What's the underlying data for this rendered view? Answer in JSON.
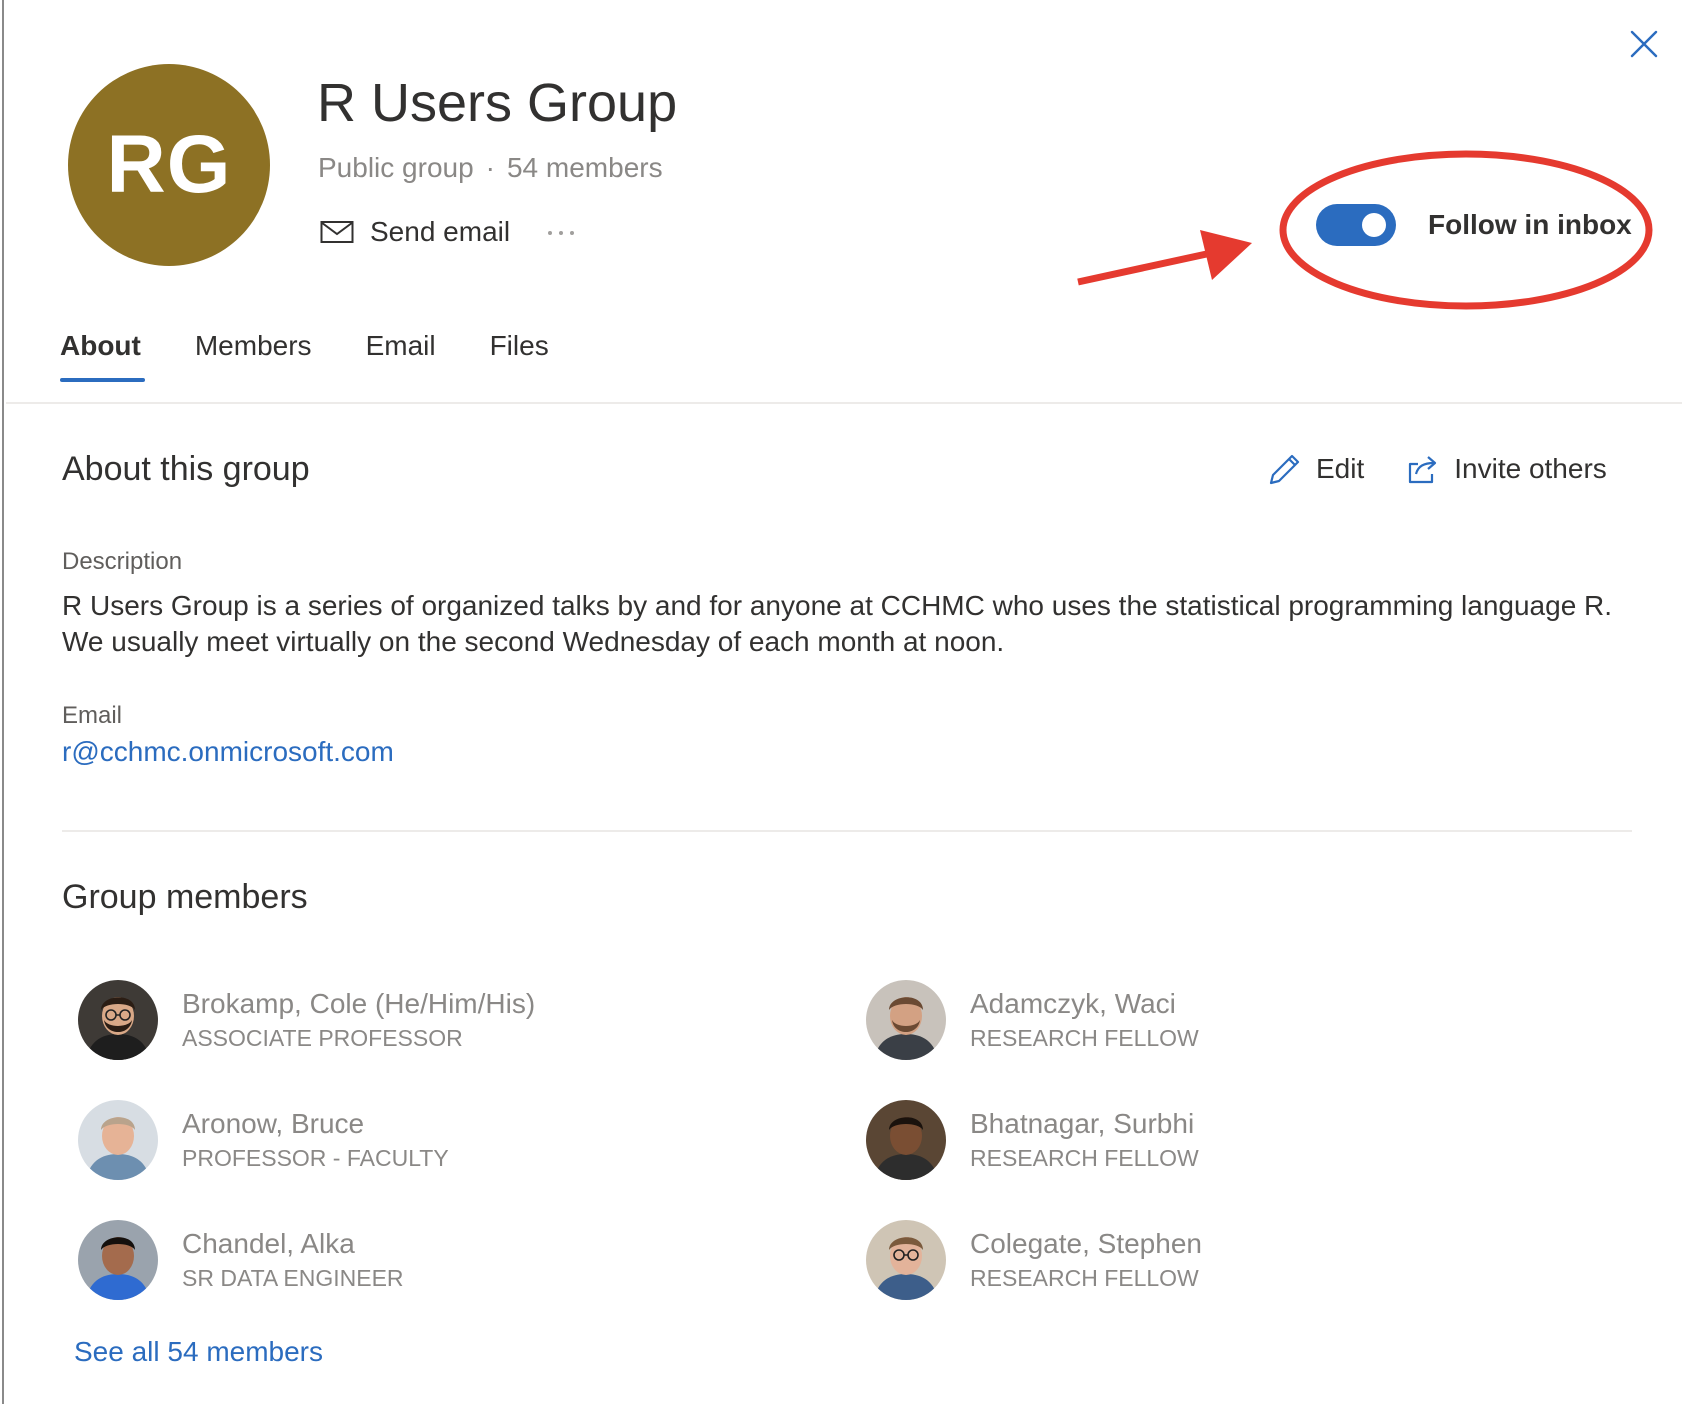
{
  "colors": {
    "avatar_bg": "#8d7124",
    "accent": "#2b6cbf",
    "toggle_on": "#2b6cbf",
    "annotation": "#e53a2f"
  },
  "header": {
    "initials": "RG",
    "title": "R Users Group",
    "visibility": "Public group",
    "separator": "·",
    "member_count": "54 members",
    "send_email_label": "Send email",
    "more_icon": "more-horizontal-icon",
    "close_icon": "close-icon",
    "follow": {
      "label": "Follow in inbox",
      "enabled": true
    }
  },
  "tabs": [
    {
      "label": "About",
      "active": true
    },
    {
      "label": "Members",
      "active": false
    },
    {
      "label": "Email",
      "active": false
    },
    {
      "label": "Files",
      "active": false
    }
  ],
  "about": {
    "title": "About this group",
    "edit_label": "Edit",
    "invite_label": "Invite others",
    "description_label": "Description",
    "description": "R Users Group is a series of organized talks by and for anyone at CCHMC who uses the statistical programming language R. We usually meet virtually on the second Wednesday of each month at noon.",
    "email_label": "Email",
    "email": "r@cchmc.onmicrosoft.com"
  },
  "members": {
    "title": "Group members",
    "list": [
      {
        "name": "Brokamp, Cole (He/Him/His)",
        "title": "ASSOCIATE PROFESSOR"
      },
      {
        "name": "Adamczyk, Waci",
        "title": "RESEARCH FELLOW"
      },
      {
        "name": "Aronow, Bruce",
        "title": "PROFESSOR - FACULTY"
      },
      {
        "name": "Bhatnagar, Surbhi",
        "title": "RESEARCH FELLOW"
      },
      {
        "name": "Chandel, Alka",
        "title": "SR DATA ENGINEER"
      },
      {
        "name": "Colegate, Stephen",
        "title": "RESEARCH FELLOW"
      }
    ],
    "see_all": "See all 54 members"
  }
}
